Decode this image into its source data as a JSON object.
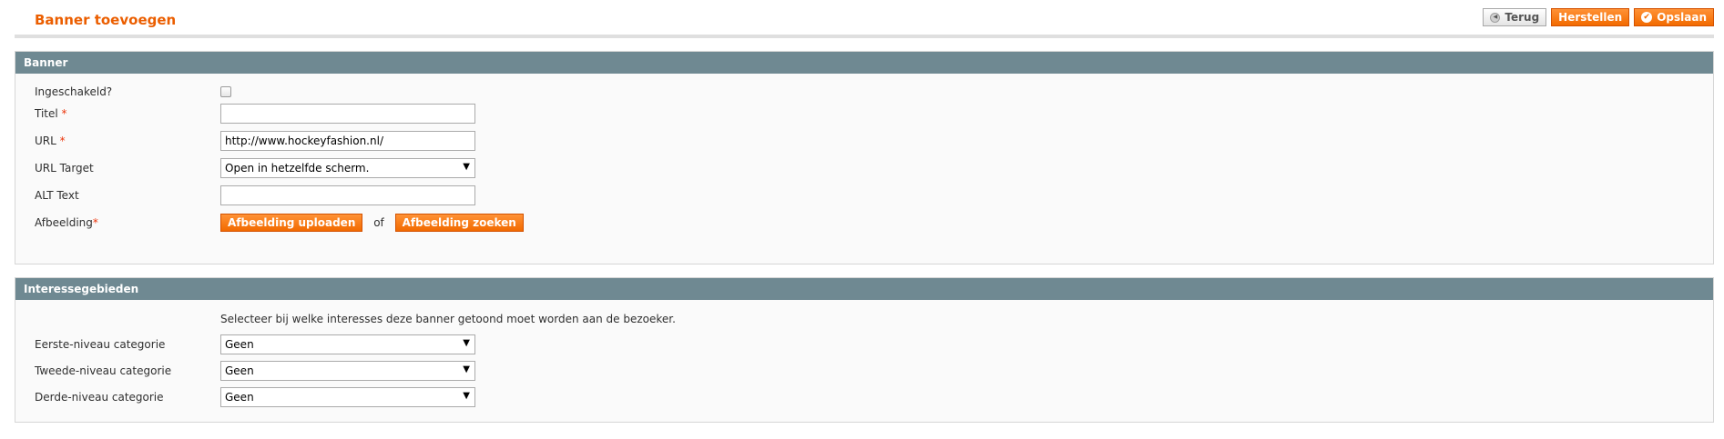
{
  "header": {
    "title": "Banner toevoegen",
    "back_label": "Terug",
    "reset_label": "Herstellen",
    "save_label": "Opslaan"
  },
  "banner": {
    "legend": "Banner",
    "enabled_label": "Ingeschakeld?",
    "enabled_checked": false,
    "title_label": "Titel",
    "title_value": "",
    "url_label": "URL",
    "url_value": "http://www.hockeyfashion.nl/",
    "target_label": "URL Target",
    "target_value": "Open in hetzelfde scherm.",
    "alt_label": "ALT Text",
    "alt_value": "",
    "image_label": "Afbeelding",
    "upload_label": "Afbeelding uploaden",
    "or_label": "of",
    "search_label": "Afbeelding zoeken",
    "required_mark": "*"
  },
  "interests": {
    "legend": "Interessegebieden",
    "note": "Selecteer bij welke interesses deze banner getoond moet worden aan de bezoeker.",
    "level1_label": "Eerste-niveau categorie",
    "level1_value": "Geen",
    "level2_label": "Tweede-niveau categorie",
    "level2_value": "Geen",
    "level3_label": "Derde-niveau categorie",
    "level3_value": "Geen"
  },
  "colors": {
    "accent": "#eb5e00",
    "section_header": "#6f8992",
    "required": "#eb340a"
  },
  "icons": {
    "back": "back-arrow-icon",
    "save": "check-circle-icon",
    "dropdown": "chevron-down-icon"
  }
}
